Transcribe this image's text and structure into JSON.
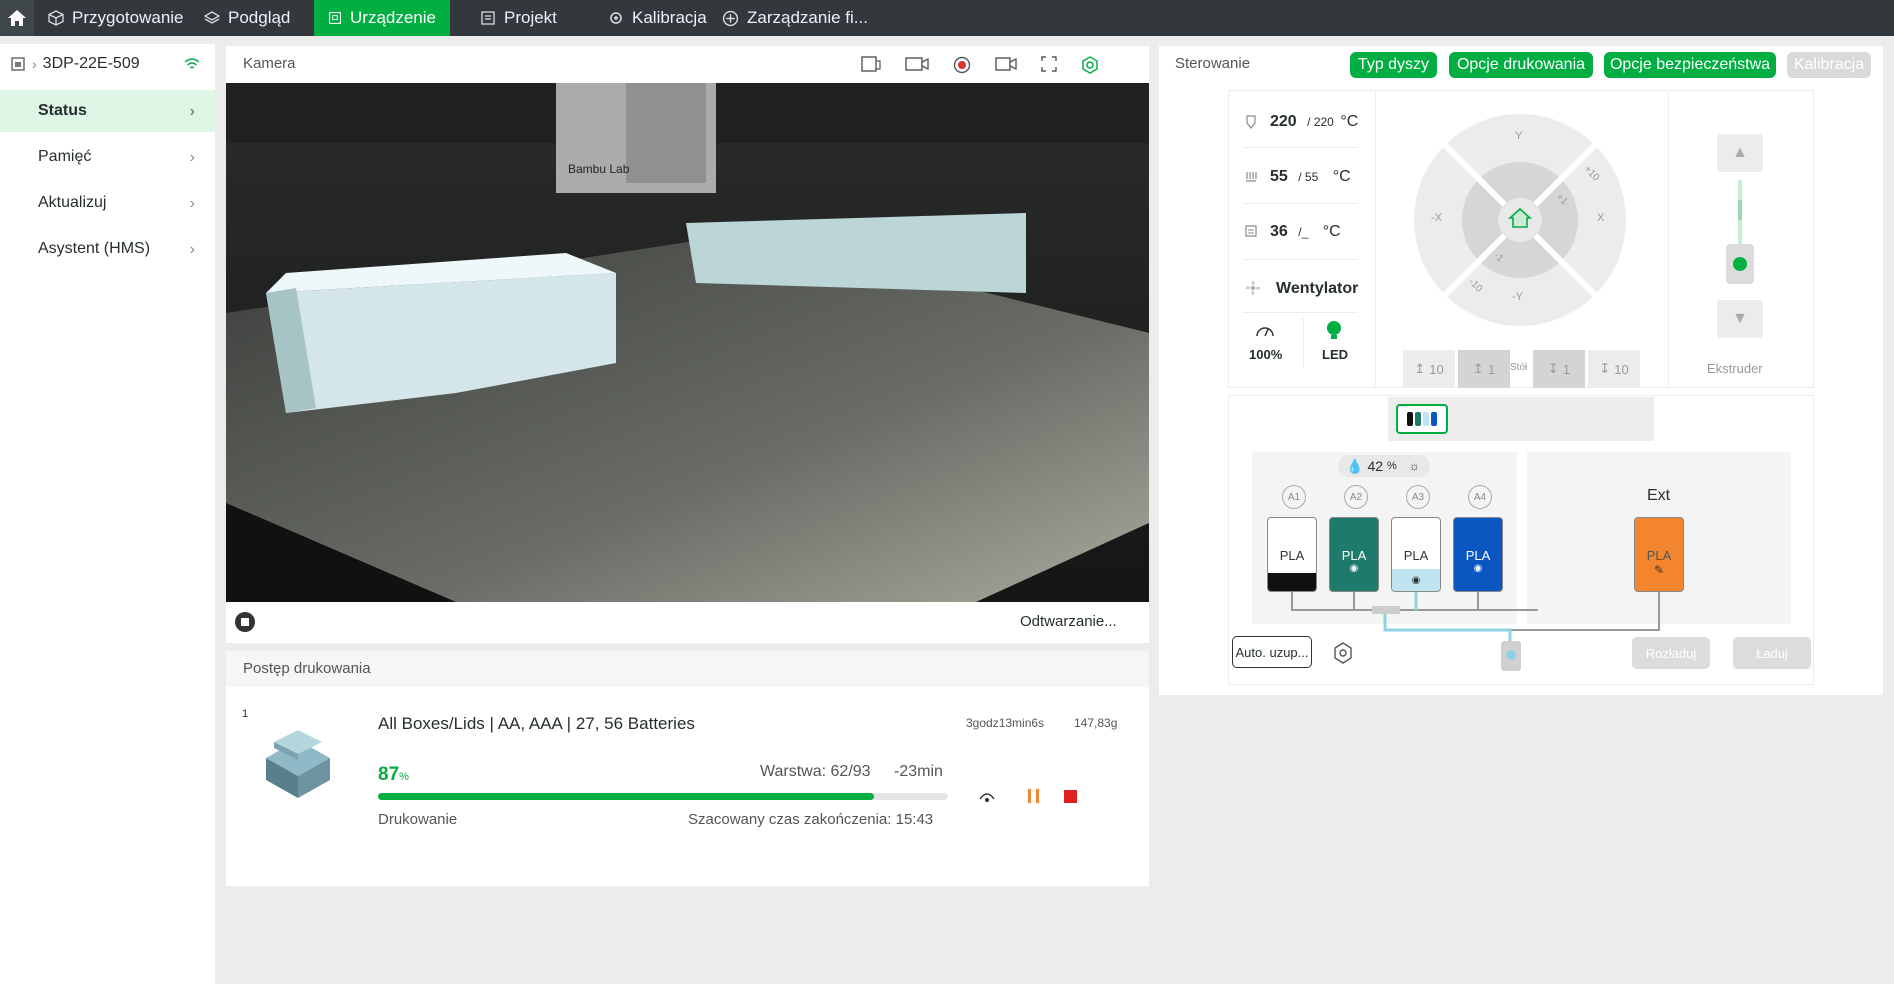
{
  "topbar": {
    "tabs": [
      {
        "label": "Przygotowanie"
      },
      {
        "label": "Podgląd"
      },
      {
        "label": "Urządzenie"
      },
      {
        "label": "Projekt"
      },
      {
        "label": "Kalibracja"
      },
      {
        "label": "Zarządzanie fi..."
      }
    ],
    "active_tab": "Urządzenie"
  },
  "sidebar": {
    "device_name": "3DP-22E-509",
    "items": [
      {
        "label": "Status"
      },
      {
        "label": "Pamięć"
      },
      {
        "label": "Aktualizuj"
      },
      {
        "label": "Asystent (HMS)"
      }
    ],
    "selected": "Status"
  },
  "camera": {
    "title": "Kamera",
    "playback_status": "Odtwarzanie...",
    "image_brand_text": "Bambu Lab"
  },
  "progress": {
    "title": "Postęp drukowania",
    "plate_number": "1",
    "job_name": "All Boxes/Lids | AA, AAA | 27, 56 Batteries",
    "total_time": "3godz13min6s",
    "weight": "147,83g",
    "percent": "87",
    "percent_unit": "%",
    "percent_value": 0.87,
    "layer_text": "Warstwa: 62/93",
    "remaining": "-23min",
    "state": "Drukowanie",
    "eta": "Szacowany czas zakończenia: 15:43"
  },
  "control": {
    "title": "Sterowanie",
    "buttons": [
      {
        "label": "Typ dyszy"
      },
      {
        "label": "Opcje drukowania"
      },
      {
        "label": "Opcje bezpieczeństwa"
      },
      {
        "label": "Kalibracja"
      }
    ],
    "nozzle": {
      "current": "220",
      "target": "/ 220",
      "unit": "°C"
    },
    "bed": {
      "current": "55",
      "target": "/ 55",
      "unit": "°C"
    },
    "chamber": {
      "current": "36",
      "target": "/_",
      "unit": "°C"
    },
    "fan_label": "Wentylator",
    "speed_label": "100%",
    "led_label": "LED",
    "jog": {
      "y": "Y",
      "neg_y": "-Y",
      "x": "X",
      "neg_x": "-X",
      "plus10": "+10",
      "plus1": "+1",
      "minus1": "-1",
      "minus10": "-10"
    },
    "bed_buttons": [
      "10",
      "1",
      "Stół",
      "1",
      "10"
    ],
    "extruder_label": "Ekstruder",
    "colors": {
      "accent": "#00ae42",
      "led": "#00ae42"
    }
  },
  "ams": {
    "humidity": "42",
    "humidity_unit": "%",
    "slots": [
      {
        "id": "A1",
        "material": "PLA",
        "color": "#111111"
      },
      {
        "id": "A2",
        "material": "PLA",
        "color": "#1e7a6a"
      },
      {
        "id": "A3",
        "material": "PLA",
        "color": "#bfe3ef"
      },
      {
        "id": "A4",
        "material": "PLA",
        "color": "#0b57c2"
      }
    ],
    "ext_label": "Ext",
    "ext_material": "PLA",
    "ext_color": "#f2852d",
    "auto_refill": "Auto. uzup...",
    "unload": "Rozładuj",
    "load": "Ładuj"
  }
}
